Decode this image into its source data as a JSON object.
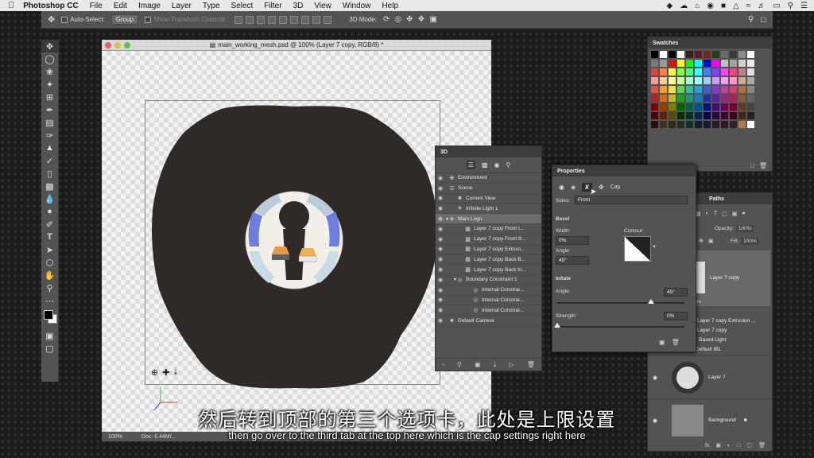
{
  "menubar": {
    "app": "Photoshop CC",
    "items": [
      "File",
      "Edit",
      "Image",
      "Layer",
      "Type",
      "Select",
      "Filter",
      "3D",
      "View",
      "Window",
      "Help"
    ]
  },
  "options": {
    "auto_select": "Auto-Select:",
    "group": "Group",
    "show_transform": "Show Transform Controls",
    "mode_3d": "3D Mode:"
  },
  "document": {
    "title": "main_working_mesh.psd @ 100% (Layer 7 copy, RGB/8) *",
    "zoom": "100%",
    "doc_size": "Doc: 6.44M/..."
  },
  "swatches": {
    "title": "Swatches",
    "colors": [
      "#000000",
      "#ffffff",
      "#000000",
      "#ffffff",
      "#3b1c20",
      "#5a1f24",
      "#6b2b1e",
      "#2b3a1f",
      "#6b6b6b",
      "#3a3a3a",
      "#8a8a8a",
      "#ffffff",
      "#7a7a7a",
      "#9a9a9a",
      "#ff0000",
      "#ffff00",
      "#00ff00",
      "#00ffff",
      "#0000ff",
      "#ff00ff",
      "#c0c0c0",
      "#a0a0a0",
      "#d0d0d0",
      "#eeeeee",
      "#e04040",
      "#ff8040",
      "#ffff40",
      "#80ff40",
      "#40ff80",
      "#40ffff",
      "#4080ff",
      "#8040ff",
      "#ff40ff",
      "#ff4080",
      "#c08080",
      "#e0e0e0",
      "#ff9999",
      "#ffcc99",
      "#ffff99",
      "#ccff99",
      "#99ffcc",
      "#99ffff",
      "#99ccff",
      "#cc99ff",
      "#ff99ff",
      "#ff99cc",
      "#ccaa88",
      "#aaaaaa",
      "#e84e4e",
      "#f0a030",
      "#f0e040",
      "#60d060",
      "#30c0a0",
      "#30a0d0",
      "#4060d0",
      "#8040c0",
      "#c040a0",
      "#d04070",
      "#b07040",
      "#888888",
      "#c02020",
      "#d07010",
      "#c0c010",
      "#20a020",
      "#10a080",
      "#1080c0",
      "#2030b0",
      "#6020a0",
      "#a02080",
      "#b02050",
      "#806030",
      "#666666",
      "#800000",
      "#904000",
      "#808000",
      "#006000",
      "#006050",
      "#005080",
      "#001080",
      "#401070",
      "#700050",
      "#700030",
      "#5a4020",
      "#444444",
      "#500000",
      "#602000",
      "#505000",
      "#003000",
      "#003028",
      "#002850",
      "#000850",
      "#280840",
      "#400030",
      "#400018",
      "#3a2810",
      "#222222",
      "#2a1010",
      "#403020",
      "#302818",
      "#203020",
      "#103030",
      "#102030",
      "#181830",
      "#281830",
      "#301828",
      "#302020",
      "#b07a40",
      "#ffffff"
    ]
  },
  "panel3d": {
    "title": "3D",
    "rows": [
      {
        "label": "Environment",
        "indent": 0,
        "icon": "environment-icon"
      },
      {
        "label": "Scene",
        "indent": 0,
        "icon": "scene-icon"
      },
      {
        "label": "Current View",
        "indent": 1,
        "icon": "camera-icon"
      },
      {
        "label": "Infinite Light 1",
        "indent": 1,
        "icon": "light-icon"
      },
      {
        "label": "Main Logo",
        "indent": 0,
        "icon": "mesh-icon",
        "selected": true
      },
      {
        "label": "Layer 7 copy Front I...",
        "indent": 2,
        "icon": "material-icon"
      },
      {
        "label": "Layer 7 copy Front B...",
        "indent": 2,
        "icon": "material-icon"
      },
      {
        "label": "Layer 7 copy Extrusi...",
        "indent": 2,
        "icon": "material-icon"
      },
      {
        "label": "Layer 7 copy Back B...",
        "indent": 2,
        "icon": "material-icon"
      },
      {
        "label": "Layer 7 copy Back In...",
        "indent": 2,
        "icon": "material-icon"
      },
      {
        "label": "Boundary Constraint 1",
        "indent": 1,
        "icon": "constraint-icon"
      },
      {
        "label": "Internal Constrai...",
        "indent": 3,
        "icon": "constraint-icon"
      },
      {
        "label": "Internal Constrai...",
        "indent": 3,
        "icon": "constraint-icon"
      },
      {
        "label": "Internal Constrai...",
        "indent": 3,
        "icon": "constraint-icon"
      },
      {
        "label": "Default Camera",
        "indent": 0,
        "icon": "camera-icon"
      }
    ]
  },
  "properties": {
    "title": "Properties",
    "tab_label": "Cap",
    "sides_label": "Sides:",
    "sides_value": "Front",
    "bevel_heading": "Bevel",
    "width_label": "Width:",
    "width_value": "0%",
    "contour_label": "Contour:",
    "angle_label": "Angle:",
    "bevel_angle_value": "45°",
    "inflate_heading": "Inflate",
    "inflate_angle_label": "Angle:",
    "inflate_angle_value": "45°",
    "strength_label": "Strength:",
    "strength_value": "0%"
  },
  "layers": {
    "tab_paths": "Paths",
    "opacity_label": "Opacity:",
    "opacity_value": "100%",
    "fill_label": "Fill:",
    "fill_value": "100%",
    "items": [
      {
        "label": "Layer 7 copy"
      },
      {
        "label": "es"
      },
      {
        "label": "Layer 7 copy Extrusion ..."
      },
      {
        "label": "Layer 7 copy"
      },
      {
        "label": "Based Light"
      },
      {
        "label": "Default IBL"
      },
      {
        "label": "Layer 7"
      },
      {
        "label": "Background"
      }
    ]
  },
  "subtitles": {
    "chinese": "然后转到顶部的第三个选项卡，此处是上限设置",
    "english": "then go over to the third tab at the top here which is the cap settings right here"
  }
}
